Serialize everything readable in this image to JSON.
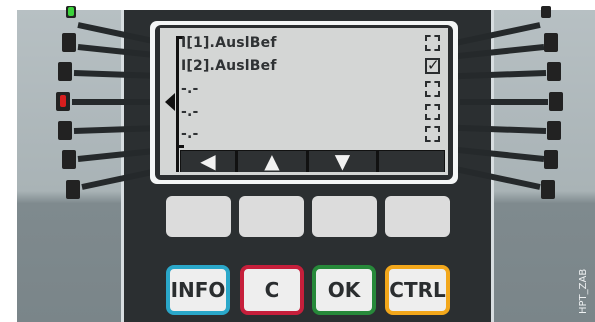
{
  "lcd": {
    "rows": [
      {
        "label": "I[1].AuslBef",
        "checked": false
      },
      {
        "label": "I[2].AuslBef",
        "checked": true
      },
      {
        "label": "-.-",
        "checked": false
      },
      {
        "label": "-.-",
        "checked": false
      },
      {
        "label": "-.-",
        "checked": false
      }
    ],
    "nav_keys": [
      "◀",
      "▲",
      "▼",
      ""
    ]
  },
  "hardkeys": {
    "info": "INFO",
    "c": "C",
    "ok": "OK",
    "ctrl": "CTRL"
  },
  "colors": {
    "info": "#2aa7c9",
    "c": "#c61f3b",
    "ok": "#27893a",
    "ctrl": "#f2a71b",
    "led_green": "#3bd23b",
    "led_red": "#d81e1e"
  },
  "side_label": "HPT_ZAB"
}
